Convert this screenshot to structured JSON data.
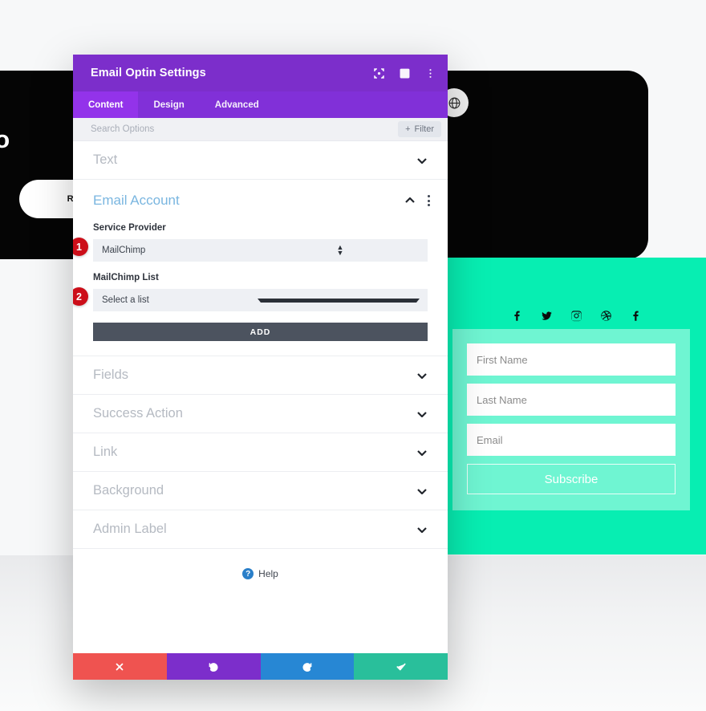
{
  "background_page": {
    "headline": "cited to",
    "request_button": "REQUEST",
    "circle_button_icon": "globe-icon",
    "social_icons": [
      "facebook-icon",
      "twitter-icon",
      "instagram-icon",
      "dribbble-icon",
      "facebook-icon"
    ],
    "optin_form": {
      "fields": [
        {
          "placeholder": "First Name"
        },
        {
          "placeholder": "Last Name"
        },
        {
          "placeholder": "Email"
        }
      ],
      "submit_label": "Subscribe"
    },
    "colors": {
      "panel_black": "#050505",
      "section_green": "#07eeb2",
      "page_light": "#f7f8f9"
    }
  },
  "modal": {
    "title": "Email Optin Settings",
    "header_icons": [
      {
        "name": "focus-icon"
      },
      {
        "name": "layout-columns-icon"
      },
      {
        "name": "more-vertical-icon"
      }
    ],
    "tabs": [
      {
        "label": "Content",
        "active": true
      },
      {
        "label": "Design",
        "active": false
      },
      {
        "label": "Advanced",
        "active": false
      }
    ],
    "search": {
      "placeholder": "Search Options",
      "value": "",
      "filter_label": "Filter",
      "filter_icon": "plus-icon"
    },
    "sections": [
      {
        "label": "Text",
        "state": "collapsed"
      },
      {
        "label": "Email Account",
        "state": "expanded"
      },
      {
        "label": "Fields",
        "state": "collapsed"
      },
      {
        "label": "Success Action",
        "state": "collapsed"
      },
      {
        "label": "Link",
        "state": "collapsed"
      },
      {
        "label": "Background",
        "state": "collapsed"
      },
      {
        "label": "Admin Label",
        "state": "collapsed"
      }
    ],
    "email_account": {
      "title": "Email Account",
      "service_provider": {
        "label": "Service Provider",
        "value": "MailChimp",
        "badge": "1"
      },
      "mailchimp_list": {
        "label": "MailChimp List",
        "value": "Select a list",
        "badge": "2"
      },
      "add_button": "ADD"
    },
    "help": {
      "label": "Help",
      "icon": "question-icon"
    },
    "footer_buttons": [
      {
        "name": "cancel-button",
        "icon": "close-icon",
        "color": "#ef5350"
      },
      {
        "name": "undo-button",
        "icon": "undo-icon",
        "color": "#7c2ecb"
      },
      {
        "name": "redo-button",
        "icon": "redo-icon",
        "color": "#2787d4"
      },
      {
        "name": "save-button",
        "icon": "check-icon",
        "color": "#29bf9b"
      }
    ],
    "colors": {
      "header_purple": "#7c2ecb",
      "tabbar_purple": "#8130d8",
      "tab_active": "#9333ea",
      "badge_red": "#cc0e19",
      "add_gray": "#4c535f"
    }
  }
}
